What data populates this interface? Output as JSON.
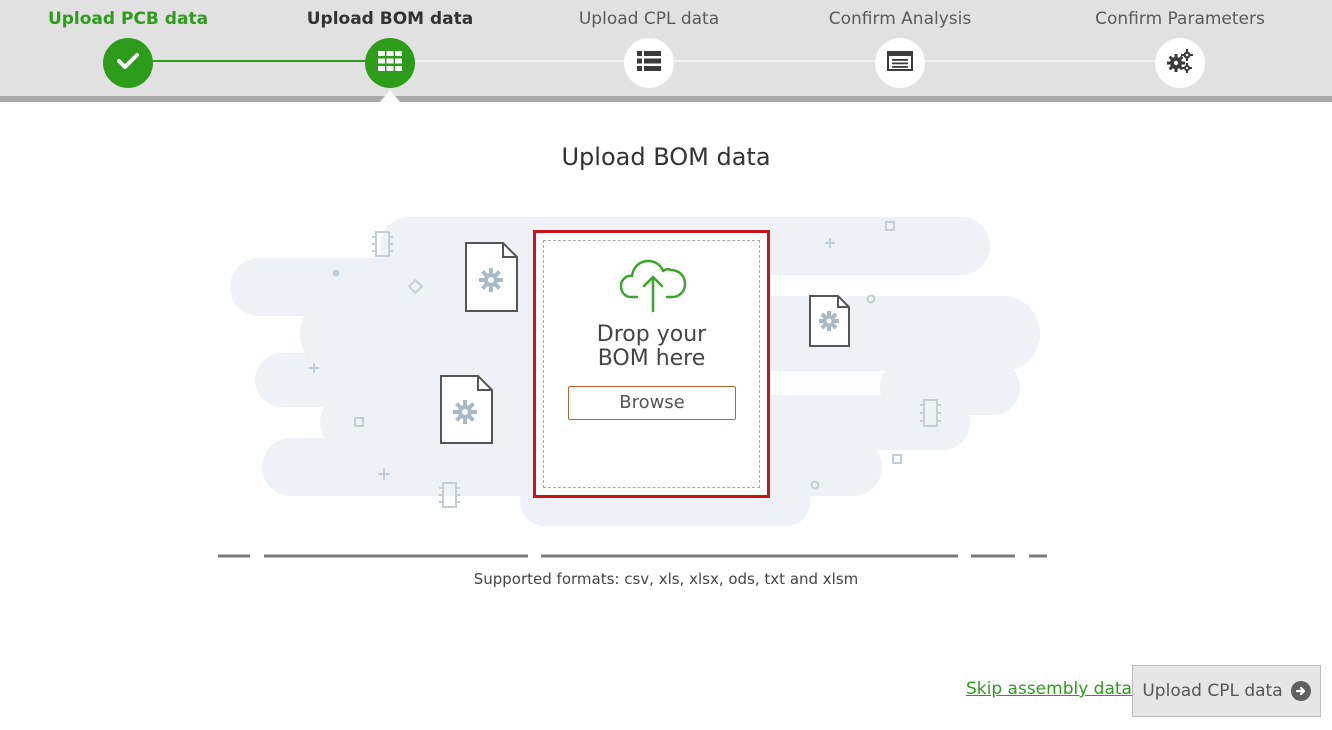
{
  "steps": [
    {
      "label": "Upload PCB data",
      "state": "done",
      "icon": "check-icon"
    },
    {
      "label": "Upload BOM data",
      "state": "active",
      "icon": "grid-icon"
    },
    {
      "label": "Upload CPL data",
      "state": "pending",
      "icon": "list-icon"
    },
    {
      "label": "Confirm Analysis",
      "state": "pending",
      "icon": "window-icon"
    },
    {
      "label": "Confirm Parameters",
      "state": "pending",
      "icon": "gears-icon"
    }
  ],
  "main": {
    "title": "Upload BOM data",
    "drop_text_line1": "Drop your",
    "drop_text_line2": "BOM here",
    "browse_label": "Browse",
    "formats": "Supported formats: csv, xls, xlsx, ods, txt and xlsm"
  },
  "footer": {
    "skip_label": "Skip assembly data",
    "next_label": "Upload CPL data"
  },
  "colors": {
    "accent": "#2e9c1b",
    "highlight": "#c8141b",
    "header_bg": "#e1e1e1"
  }
}
